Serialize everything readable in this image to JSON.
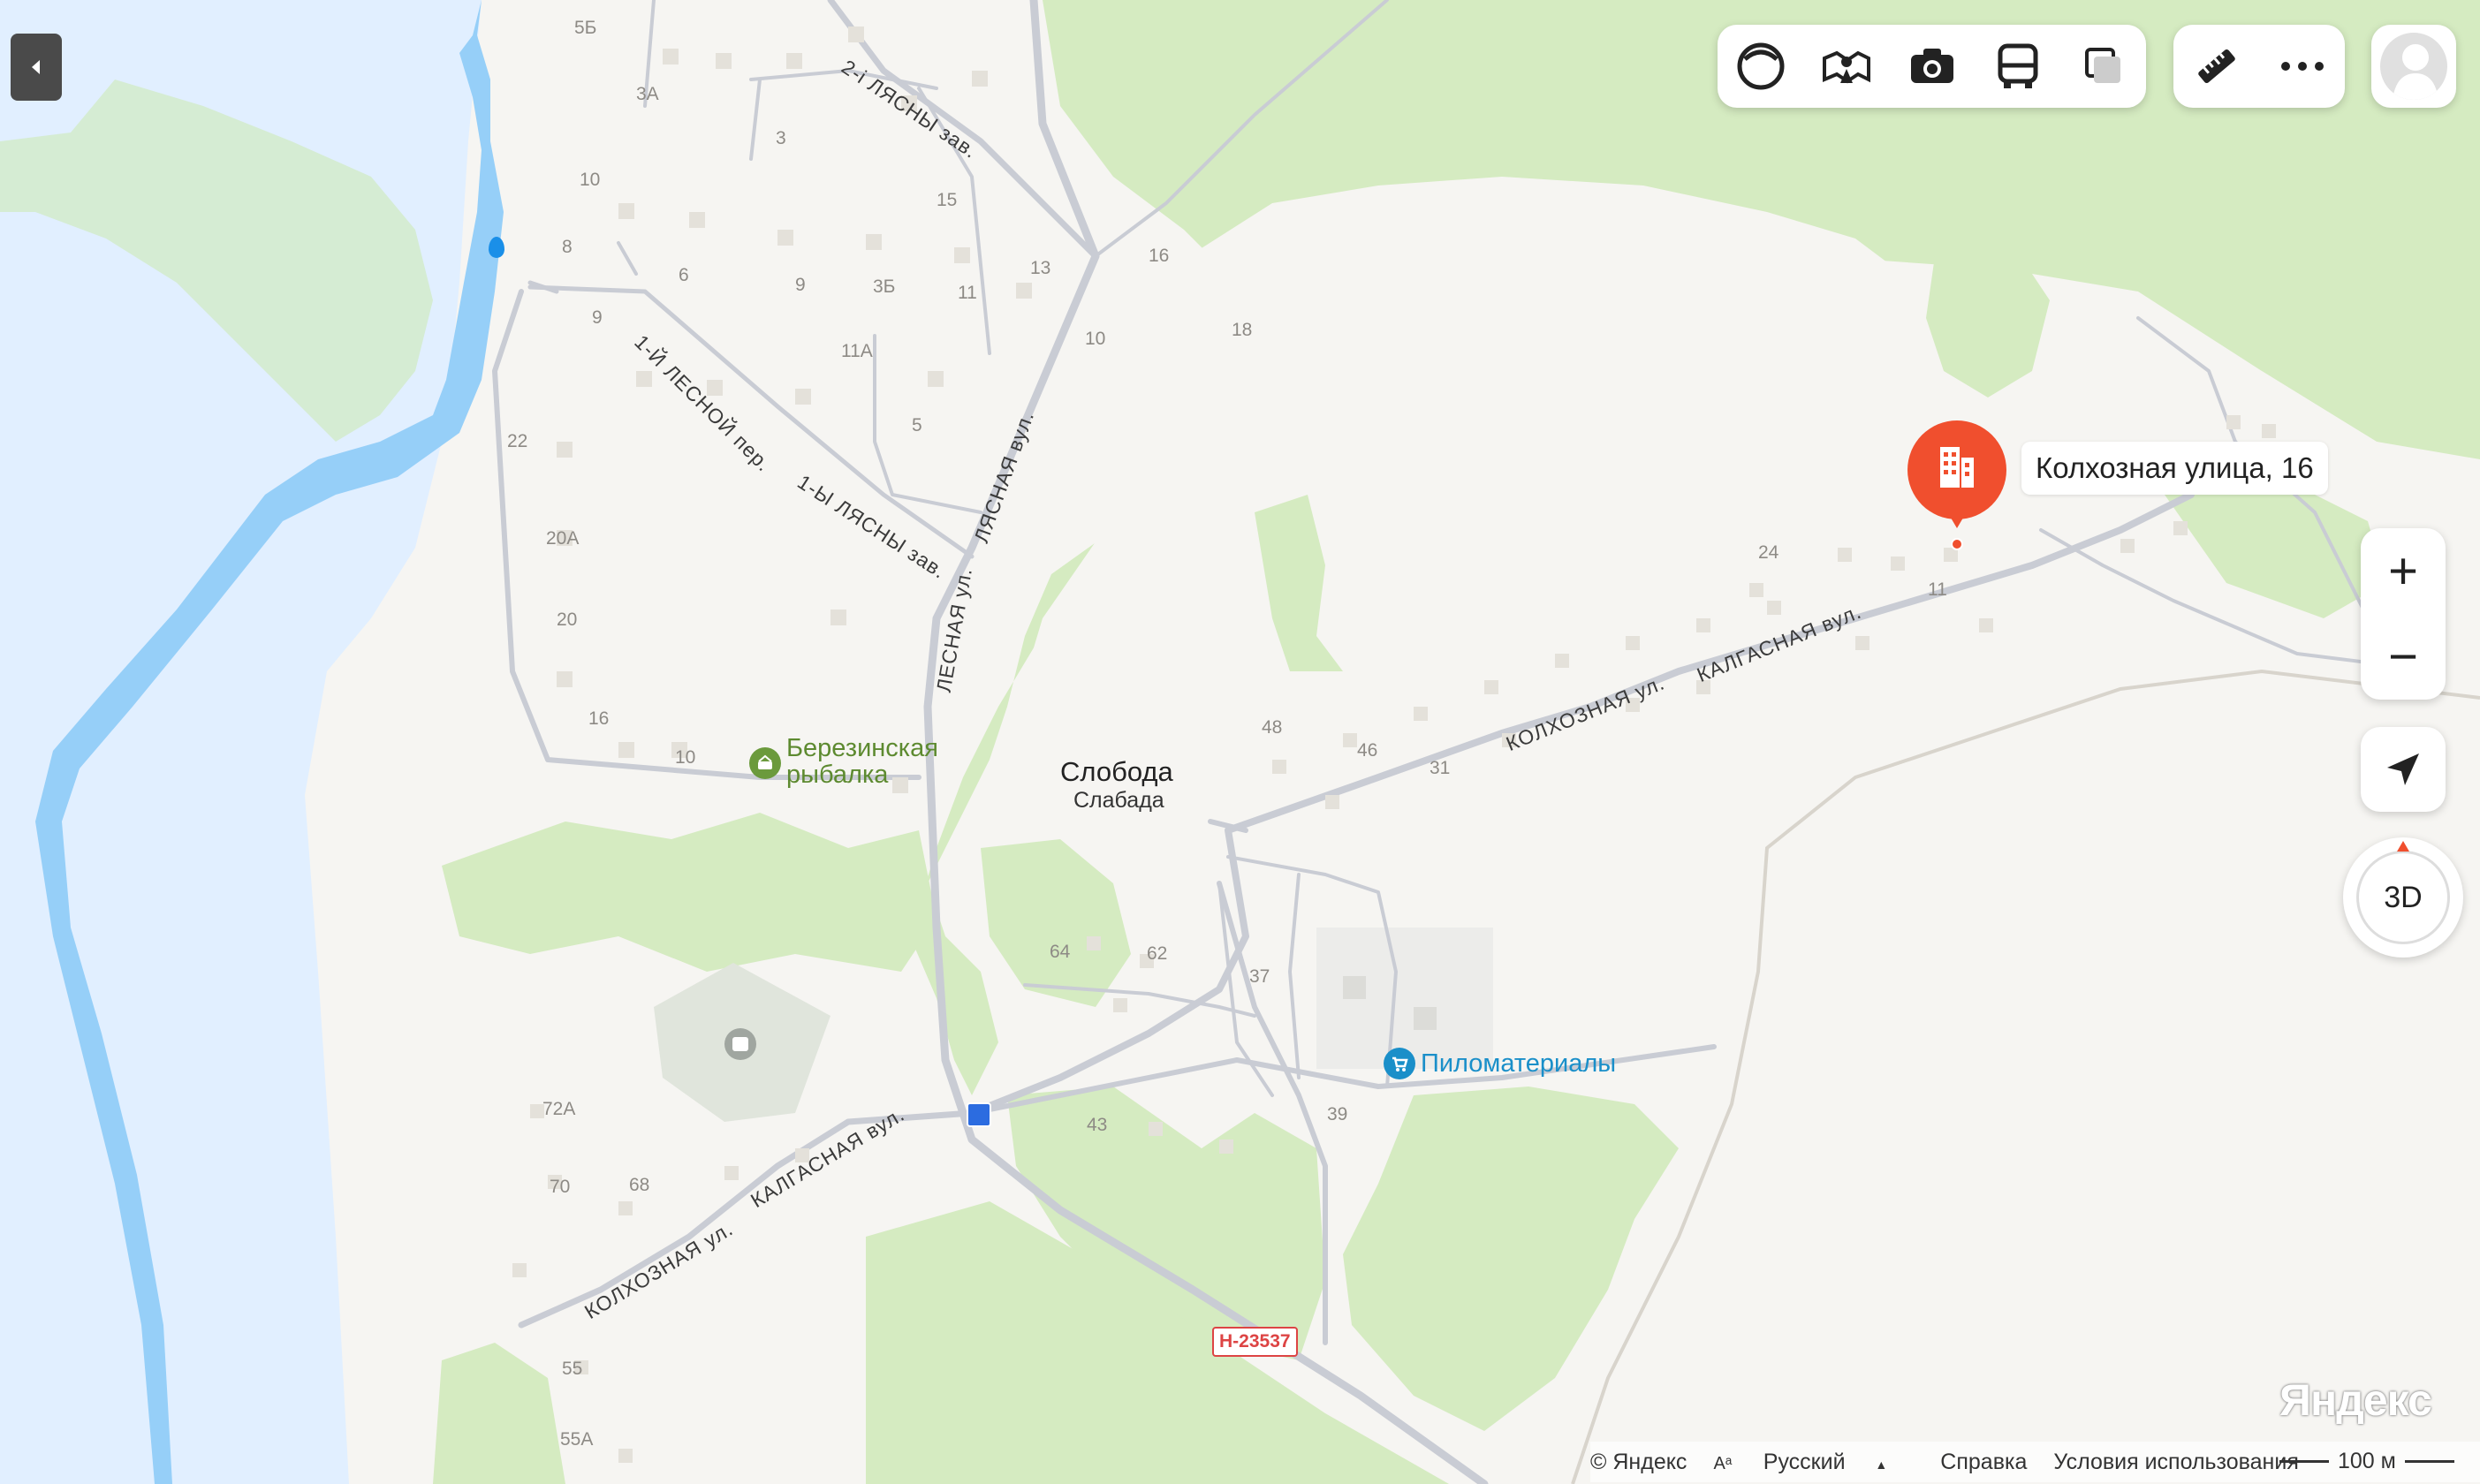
{
  "map": {
    "settlement": {
      "name": "Слобода",
      "alt_name": "Слабада"
    },
    "streets": [
      "2-і ЛЯСНЫ зав.",
      "1-Й ЛЕСНОЙ пер.",
      "1-Ы ЛЯСНЫ зав.",
      "ЛЯСНАЯ вул.",
      "ЛЕСНАЯ ул.",
      "КОЛХОЗНАЯ ул.",
      "КАЛГАСНАЯ вул.",
      "КАЛГАСНАЯ вул.",
      "КОЛХОЗНАЯ ул."
    ],
    "house_numbers": [
      "5Б",
      "3А",
      "3",
      "15",
      "10",
      "8",
      "6",
      "9",
      "3Б",
      "11",
      "13",
      "16",
      "9",
      "10",
      "18",
      "11А",
      "5",
      "22",
      "20А",
      "20",
      "16",
      "10",
      "24",
      "11",
      "48",
      "46",
      "31",
      "64",
      "62",
      "37",
      "43",
      "39",
      "72А",
      "70",
      "68",
      "55",
      "55А"
    ],
    "pois": [
      {
        "name_line1": "Березинская",
        "name_line2": "рыбалка",
        "icon": "fishing-icon",
        "color": "#6b9a3c"
      },
      {
        "name": "Пиломатериалы",
        "icon": "shop-cart-icon",
        "color": "#1a8fc9"
      }
    ],
    "road_shield": "Н-23537",
    "selected_place": {
      "label": "Колхозная улица, 16",
      "icon": "building-icon",
      "color": "#f04f2e"
    }
  },
  "toolbar": {
    "layers": [
      "traffic-layer-icon",
      "panorama-icon",
      "photo-icon",
      "transport-icon",
      "map-layers-icon"
    ],
    "tools": [
      "ruler-icon",
      "more-icon"
    ]
  },
  "controls": {
    "zoom_in": "+",
    "zoom_out": "−",
    "view_3d": "3D"
  },
  "footer": {
    "copyright": "© Яндекс",
    "language": "Русский",
    "help": "Справка",
    "terms": "Условия использования",
    "scale": "100 м"
  },
  "logo": "Яндекс"
}
